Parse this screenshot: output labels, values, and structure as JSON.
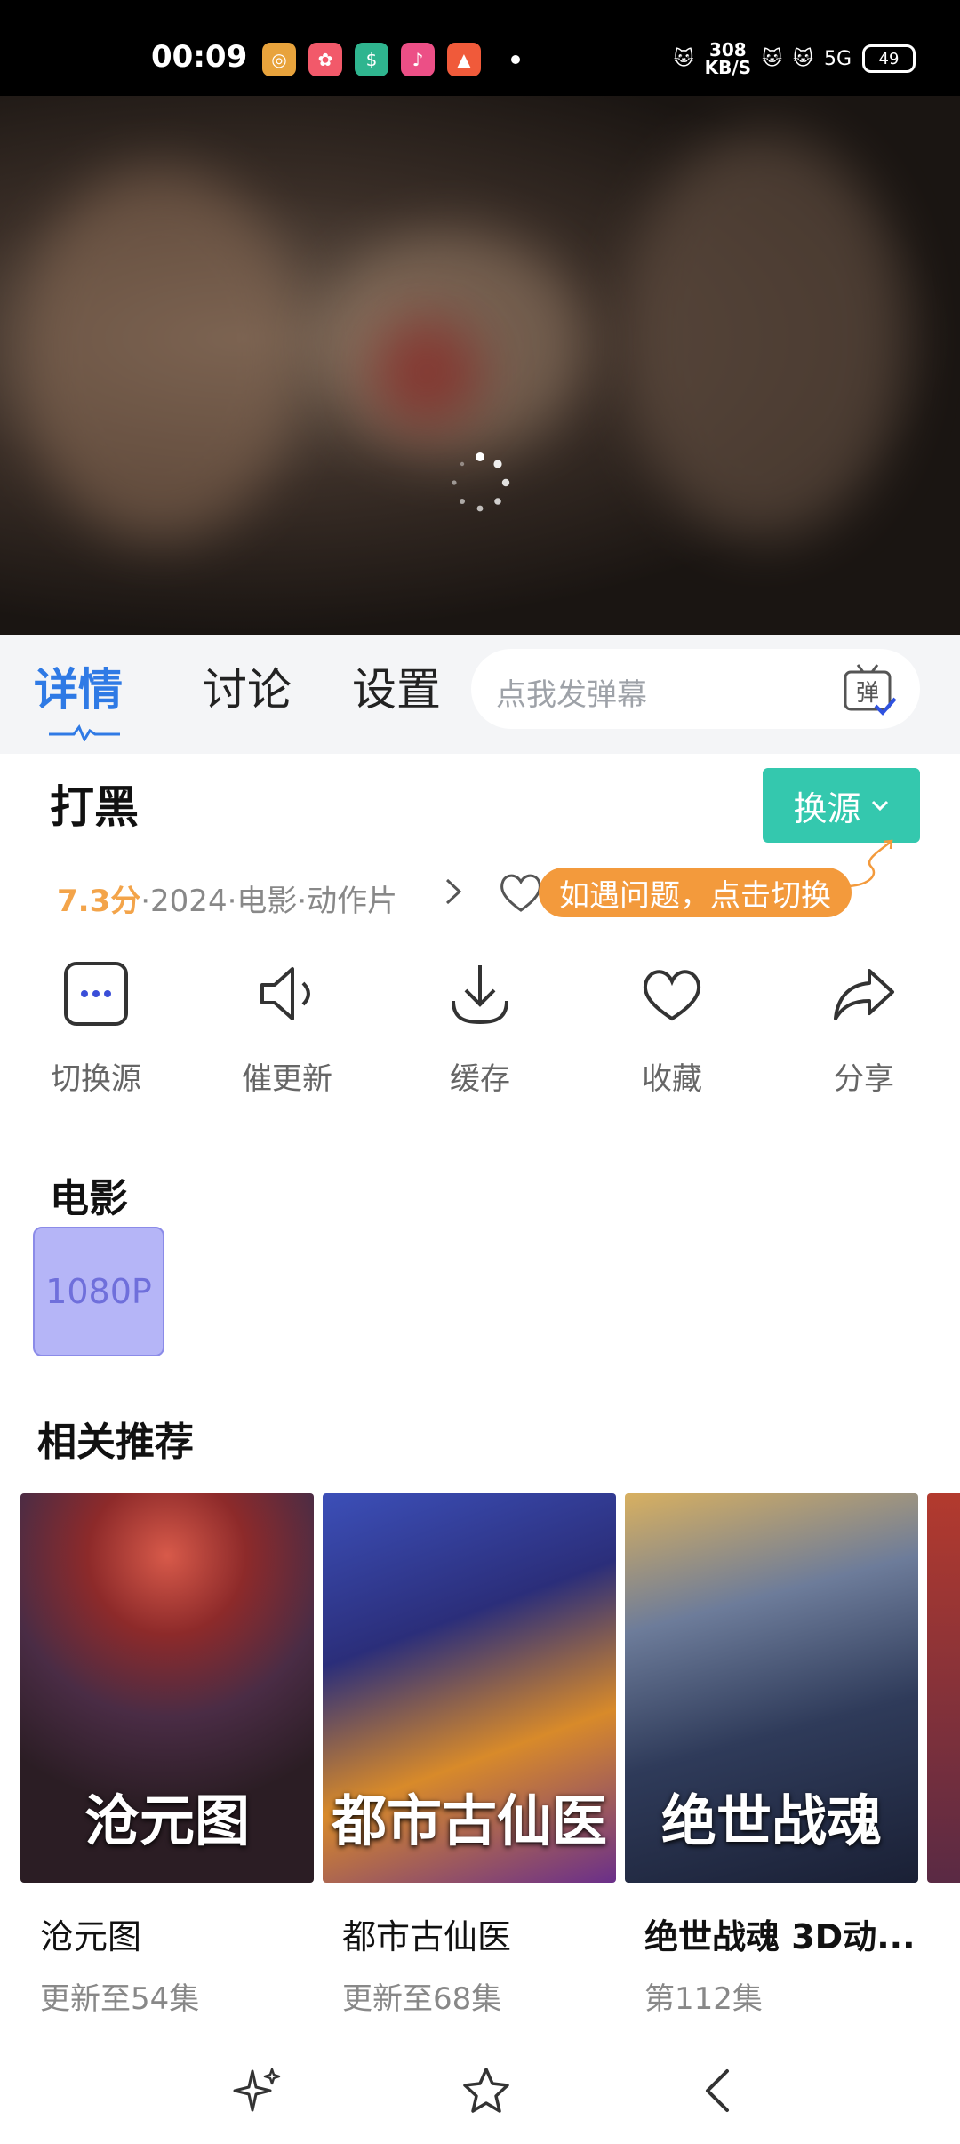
{
  "status_bar": {
    "time": "00:09",
    "net_speed_value": "308",
    "net_speed_unit": "KB/S",
    "signal": "5G",
    "battery": "49"
  },
  "player": {
    "state": "loading"
  },
  "tabs": [
    {
      "label": "详情",
      "active": true
    },
    {
      "label": "讨论",
      "active": false
    },
    {
      "label": "设置",
      "active": false
    }
  ],
  "danmu": {
    "placeholder": "点我发弹幕",
    "icon_label": "弹"
  },
  "movie": {
    "title": "打黑",
    "score": "7.3分",
    "meta": "·2024·电影·动作片",
    "source_button": "换源",
    "tooltip": "如遇问题，点击切换"
  },
  "actions": [
    {
      "label": "切换源",
      "icon": "more-dots-icon"
    },
    {
      "label": "催更新",
      "icon": "speaker-icon"
    },
    {
      "label": "缓存",
      "icon": "download-icon"
    },
    {
      "label": "收藏",
      "icon": "heart-icon"
    },
    {
      "label": "分享",
      "icon": "share-icon"
    }
  ],
  "episodes": {
    "section_title": "电影",
    "items": [
      "1080P"
    ]
  },
  "recommendations": {
    "section_title": "相关推荐",
    "items": [
      {
        "title": "沧元图",
        "subtitle": "更新至54集",
        "poster_text": "沧元图"
      },
      {
        "title": "都市古仙医",
        "subtitle": "更新至68集",
        "poster_text": "都市古仙医"
      },
      {
        "title": "绝世战魂 3D动...",
        "subtitle": "第112集",
        "poster_text": "绝世战魂"
      }
    ]
  },
  "colors": {
    "accent_blue": "#2f7ae5",
    "source_green": "#34c8ae",
    "score_orange": "#f3a44a",
    "tooltip_orange": "#f39a3c",
    "quality_purple": "#b5b5f7"
  }
}
